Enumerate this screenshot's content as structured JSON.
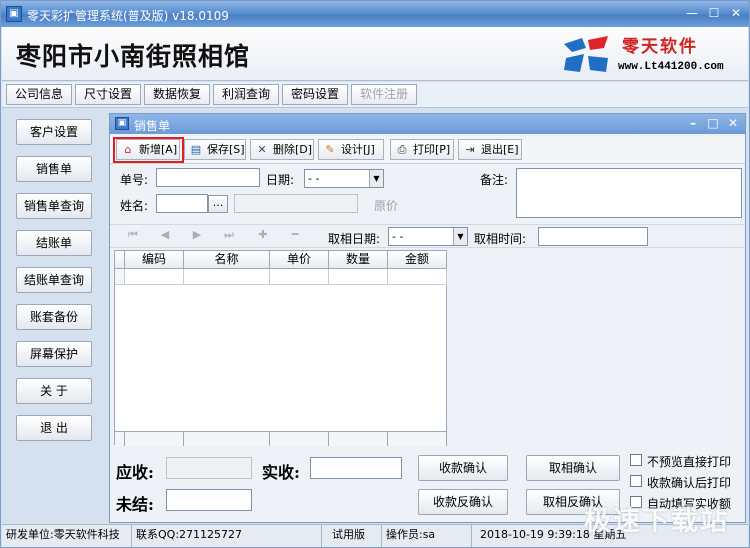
{
  "window": {
    "title": "零天彩扩管理系统(普及版)  v18.0109",
    "minimize": "0",
    "maximize": "1",
    "close": "r"
  },
  "header": {
    "company": "枣阳市小南街照相馆",
    "logo_text": "零天软件",
    "logo_url": "www.Lt441200.com"
  },
  "tabs": [
    {
      "label": "公司信息",
      "enabled": true
    },
    {
      "label": "尺寸设置",
      "enabled": true
    },
    {
      "label": "数据恢复",
      "enabled": true
    },
    {
      "label": "利润查询",
      "enabled": true
    },
    {
      "label": "密码设置",
      "enabled": true
    },
    {
      "label": "软件注册",
      "enabled": false
    }
  ],
  "nav": [
    "客户设置",
    "销售单",
    "销售单查询",
    "结账单",
    "结账单查询",
    "账套备份",
    "屏幕保护",
    "关 于",
    "退 出"
  ],
  "inner": {
    "title": "销售单",
    "toolbar": [
      {
        "label": "新增[A]",
        "icon": "home-icon"
      },
      {
        "label": "保存[S]",
        "icon": "save-icon"
      },
      {
        "label": "删除[D]",
        "icon": "delete-icon"
      },
      {
        "label": "设计[J]",
        "icon": "design-icon"
      },
      {
        "label": "打印[P]",
        "icon": "print-icon"
      },
      {
        "label": "退出[E]",
        "icon": "exit-icon"
      }
    ],
    "form": {
      "order_no_label": "单号:",
      "date_label": "日期:",
      "date_value": "  -  -",
      "remark_label": "备注:",
      "name_label": "姓名:",
      "browse": "...",
      "original_price": "原价",
      "pickup_date_label": "取相日期:",
      "pickup_date_value": "  -  -",
      "pickup_time_label": "取相时间:"
    },
    "grid_columns": [
      "编码",
      "名称",
      "单价",
      "数量",
      "金额"
    ],
    "bottom": {
      "receivable_label": "应收:",
      "received_label": "实收:",
      "outstanding_label": "未结:",
      "buttons": [
        "收款确认",
        "取相确认",
        "收款反确认",
        "取相反确认"
      ],
      "checks": [
        "不预览直接打印",
        "收款确认后打印",
        "自动填写实收额"
      ]
    }
  },
  "status": {
    "developer": "研发单位:零天软件科技",
    "qq": "联系QQ:271125727",
    "edition": "试用版",
    "operator": "操作员:sa",
    "datetime": "2018-10-19  9:39:18  星期五"
  },
  "watermark": "极速下载站"
}
